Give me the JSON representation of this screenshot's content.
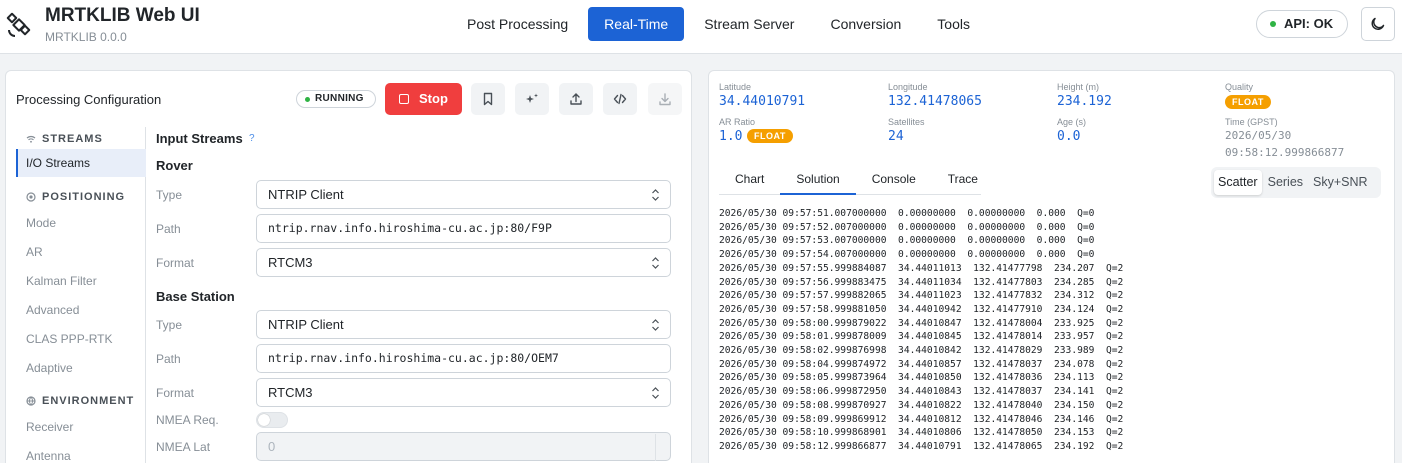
{
  "app": {
    "title": "MRTKLIB Web UI",
    "version": "MRTKLIB 0.0.0"
  },
  "nav": [
    {
      "label": "Post Processing",
      "active": false
    },
    {
      "label": "Real-Time",
      "active": true
    },
    {
      "label": "Stream Server",
      "active": false
    },
    {
      "label": "Conversion",
      "active": false
    },
    {
      "label": "Tools",
      "active": false
    }
  ],
  "api_status": "API: OK",
  "colors": {
    "primary": "#1c63d5",
    "stop": "#f03e3e",
    "ok": "#2fb344",
    "float": "#f59f00"
  },
  "config": {
    "title": "Processing Configuration",
    "status": "RUNNING",
    "stop_label": "Stop",
    "toolbar_icons": [
      "bookmark-icon",
      "sparkles-icon",
      "upload-icon",
      "code-icon",
      "download-icon"
    ]
  },
  "sidebar": {
    "sections": [
      {
        "label": "STREAMS",
        "icon": "wifi-icon"
      },
      {
        "label": "POSITIONING",
        "icon": "target-icon"
      },
      {
        "label": "ENVIRONMENT",
        "icon": "globe-icon"
      }
    ],
    "items": [
      "I/O Streams",
      "Mode",
      "AR",
      "Kalman Filter",
      "Advanced",
      "CLAS PPP-RTK",
      "Adaptive",
      "Receiver",
      "Antenna"
    ],
    "active_item": "I/O Streams"
  },
  "form": {
    "heading": "Input Streams",
    "help": "?",
    "rover": {
      "heading": "Rover",
      "type_label": "Type",
      "type": "NTRIP Client",
      "path_label": "Path",
      "path": "ntrip.rnav.info.hiroshima-cu.ac.jp:80/F9P",
      "format_label": "Format",
      "format": "RTCM3"
    },
    "base": {
      "heading": "Base Station",
      "type_label": "Type",
      "type": "NTRIP Client",
      "path_label": "Path",
      "path": "ntrip.rnav.info.hiroshima-cu.ac.jp:80/OEM7",
      "format_label": "Format",
      "format": "RTCM3"
    },
    "nmea_req_label": "NMEA Req.",
    "nmea_req": false,
    "nmea_lat_label": "NMEA Lat",
    "nmea_lat_placeholder": "0"
  },
  "solution": {
    "latitude_label": "Latitude",
    "latitude": "34.44010791",
    "longitude_label": "Longitude",
    "longitude": "132.41478065",
    "height_label": "Height (m)",
    "height": "234.192",
    "quality_label": "Quality",
    "quality": "FLOAT",
    "ar_ratio_label": "AR Ratio",
    "ar_ratio": "1.0",
    "ar_status": "FLOAT",
    "satellites_label": "Satellites",
    "satellites": "24",
    "age_label": "Age (s)",
    "age": "0.0",
    "time_label": "Time (GPST)",
    "time_date": "2026/05/30",
    "time_clock": "09:58:12.999866877"
  },
  "tabs": [
    {
      "label": "Chart",
      "active": false
    },
    {
      "label": "Solution",
      "active": true
    },
    {
      "label": "Console",
      "active": false
    },
    {
      "label": "Trace",
      "active": false
    }
  ],
  "view_modes": [
    {
      "label": "Scatter",
      "active": true
    },
    {
      "label": "Series",
      "active": false
    },
    {
      "label": "Sky+SNR",
      "active": false
    }
  ],
  "log_lines": [
    "2026/05/30 09:57:51.007000000  0.00000000  0.00000000  0.000  Q=0",
    "2026/05/30 09:57:52.007000000  0.00000000  0.00000000  0.000  Q=0",
    "2026/05/30 09:57:53.007000000  0.00000000  0.00000000  0.000  Q=0",
    "2026/05/30 09:57:54.007000000  0.00000000  0.00000000  0.000  Q=0",
    "2026/05/30 09:57:55.999884087  34.44011013  132.41477798  234.207  Q=2",
    "2026/05/30 09:57:56.999883475  34.44011034  132.41477803  234.285  Q=2",
    "2026/05/30 09:57:57.999882065  34.44011023  132.41477832  234.312  Q=2",
    "2026/05/30 09:57:58.999881050  34.44010942  132.41477910  234.124  Q=2",
    "2026/05/30 09:58:00.999879022  34.44010847  132.41478004  233.925  Q=2",
    "2026/05/30 09:58:01.999878009  34.44010845  132.41478014  233.957  Q=2",
    "2026/05/30 09:58:02.999876998  34.44010842  132.41478029  233.989  Q=2",
    "2026/05/30 09:58:04.999874972  34.44010857  132.41478037  234.078  Q=2",
    "2026/05/30 09:58:05.999873964  34.44010850  132.41478036  234.113  Q=2",
    "2026/05/30 09:58:06.999872950  34.44010843  132.41478037  234.141  Q=2",
    "2026/05/30 09:58:08.999870927  34.44010822  132.41478040  234.150  Q=2",
    "2026/05/30 09:58:09.999869912  34.44010812  132.41478046  234.146  Q=2",
    "2026/05/30 09:58:10.999868901  34.44010806  132.41478050  234.153  Q=2",
    "2026/05/30 09:58:12.999866877  34.44010791  132.41478065  234.192  Q=2"
  ]
}
